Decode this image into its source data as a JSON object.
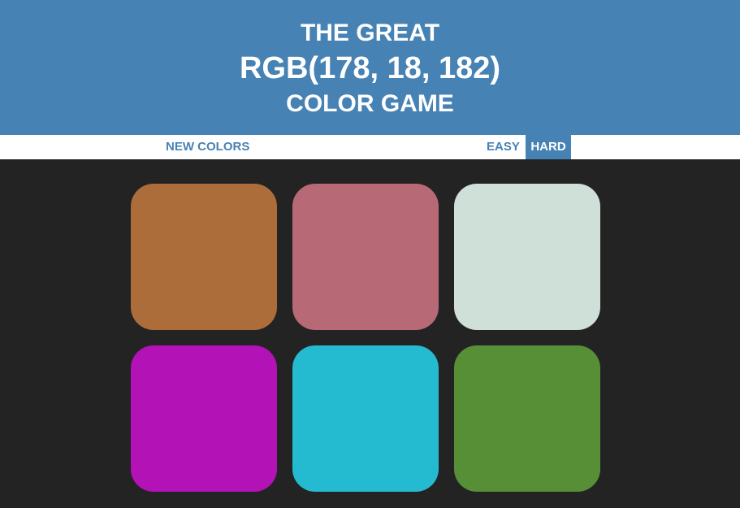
{
  "header": {
    "title_top": "THE GREAT",
    "target_color": "RGB(178, 18, 182)",
    "title_bottom": "COLOR GAME",
    "background": "#4682b4"
  },
  "controls": {
    "new_colors_label": "NEW COLORS",
    "easy_label": "EASY",
    "hard_label": "HARD",
    "selected_mode": "HARD"
  },
  "board": {
    "background": "#232323",
    "squares": [
      {
        "color": "#ad6d3b"
      },
      {
        "color": "#b76a75"
      },
      {
        "color": "#cfe0d9"
      },
      {
        "color": "#b212b6"
      },
      {
        "color": "#24bacf"
      },
      {
        "color": "#578f36"
      }
    ]
  }
}
